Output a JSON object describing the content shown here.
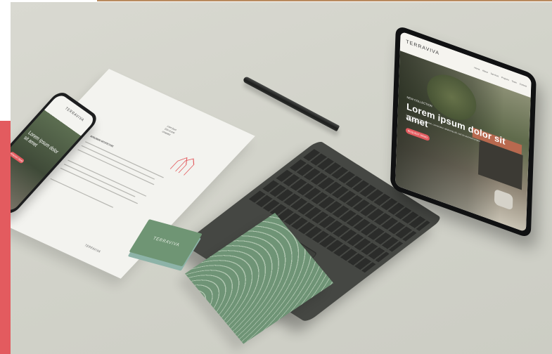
{
  "brand": {
    "name": "TERRAVIVA",
    "accent_color": "#e35b5f",
    "brand_green": "#6f9574"
  },
  "tablet": {
    "logo": "TERRAVIVA",
    "menu": "Home  About  Services  Projects  Team  Contact",
    "eyebrow": "NEW COLLECTION",
    "headline": "Lorem ipsum dolor sit amet",
    "body": "Lorem ipsum dolor sit amet, consectetur adipiscing elit, sed do eiusmod tempor incididunt ut labore.",
    "cta": "REQUEST DEMO"
  },
  "phone": {
    "logo": "TERRAVIVA",
    "headline": "Lorem ipsum dolor sit amet",
    "cta": "REQUEST DEMO"
  },
  "letterhead": {
    "heading": "WORLDWIDE ARCHITECTURE",
    "footer_logo": "TERRAVIVA"
  },
  "business_card": {
    "logo": "TERRAVIVA"
  }
}
